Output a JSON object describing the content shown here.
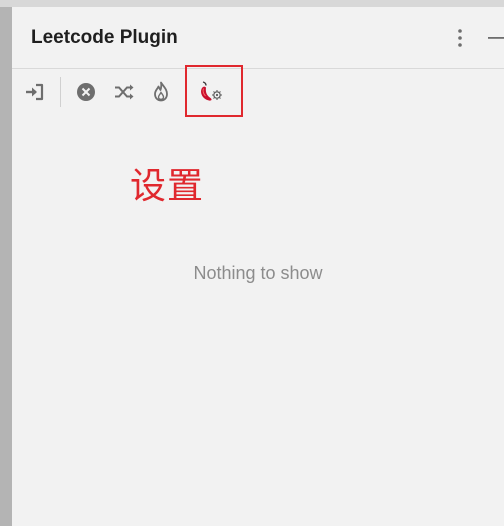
{
  "panel": {
    "title": "Leetcode Plugin",
    "empty_message": "Nothing to show"
  },
  "toolbar": {
    "items": [
      {
        "name": "login",
        "icon": "sign-in-icon"
      },
      {
        "name": "logout",
        "icon": "close-circle-icon"
      },
      {
        "name": "random-question",
        "icon": "shuffle-icon"
      },
      {
        "name": "hot-questions",
        "icon": "flame-icon"
      },
      {
        "name": "settings",
        "icon": "chili-settings-icon"
      }
    ]
  },
  "header_actions": {
    "more_icon": "more-vertical-icon",
    "minimize_icon": "minimize-icon"
  },
  "annotation": {
    "label": "设置",
    "color": "#e0282e"
  },
  "colors": {
    "panel_background": "#f2f2f2",
    "accent_red": "#e0282e",
    "icon_gray": "#6e6e6e",
    "empty_text": "#8c8c8c"
  }
}
